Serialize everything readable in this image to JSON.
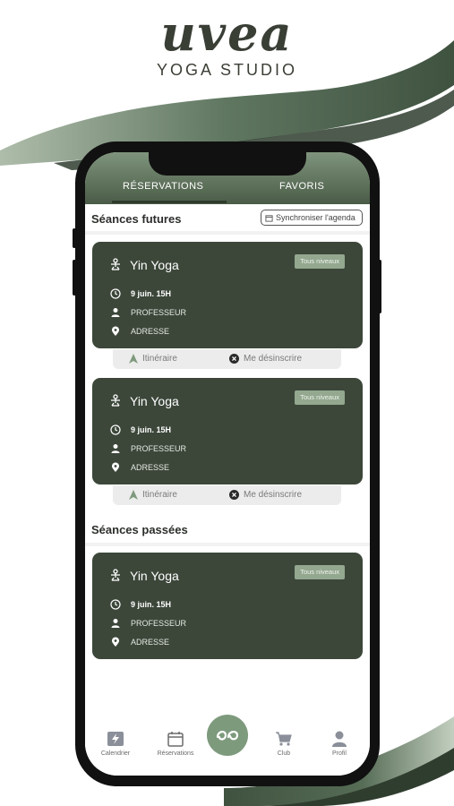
{
  "brand": {
    "wordmark": "uvea",
    "tagline": "YOGA STUDIO"
  },
  "tabs": [
    {
      "label": "RÉSERVATIONS",
      "active": true
    },
    {
      "label": "FAVORIS",
      "active": false
    }
  ],
  "sections": {
    "future_title": "Séances futures",
    "past_title": "Séances passées",
    "sync_label": "Synchroniser l'agenda"
  },
  "cards": [
    {
      "title": "Yin Yoga",
      "badge": "Tous niveaux",
      "time": "9 juin. 15H",
      "teacher": "PROFESSEUR",
      "address": "ADRESSE",
      "itinerary": "Itinéraire",
      "unsubscribe": "Me désinscrire"
    },
    {
      "title": "Yin Yoga",
      "badge": "Tous niveaux",
      "time": "9 juin. 15H",
      "teacher": "PROFESSEUR",
      "address": "ADRESSE",
      "itinerary": "Itinéraire",
      "unsubscribe": "Me désinscrire"
    },
    {
      "title": "Yin Yoga",
      "badge": "Tous niveaux",
      "time": "9 juin. 15H",
      "teacher": "PROFESSEUR",
      "address": "ADRESSE"
    }
  ],
  "nav": [
    {
      "label": "Calendrier",
      "icon": "lightning-calendar-icon"
    },
    {
      "label": "Réservations",
      "icon": "calendar-icon"
    },
    {
      "label": "",
      "icon": "uvea-logo-icon"
    },
    {
      "label": "Club",
      "icon": "cart-icon"
    },
    {
      "label": "Profil",
      "icon": "user-icon"
    }
  ],
  "colors": {
    "card": "#3c473a",
    "accent": "#7e9a7d",
    "badge": "#93a88f",
    "text_dark": "#2b2f2a"
  }
}
